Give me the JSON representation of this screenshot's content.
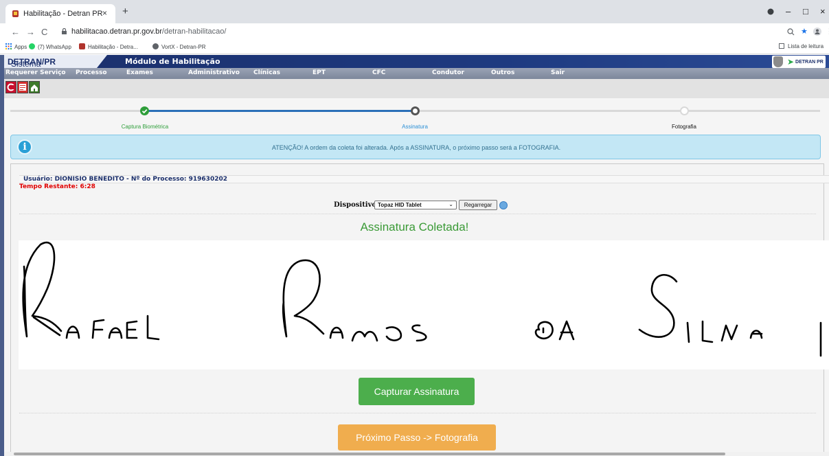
{
  "browser": {
    "tab_title": "Habilitação - Detran PR",
    "tab_close": "×",
    "new_tab": "+",
    "url_host": "habilitacao.detran.pr.gov.br",
    "url_path": "/detran-habilitacao/",
    "window_controls": [
      "–",
      "□",
      "×"
    ],
    "bookmarks": [
      "Apps",
      "(7) WhatsApp",
      "Habilitação - Detra...",
      "VortX - Detran-PR"
    ],
    "reading_list": "Lista de leitura"
  },
  "header": {
    "sistema_prefix": "Sistema",
    "sistema_bold": "DETRAN/PR",
    "modulo": "Módulo de Habilitação",
    "logo_text": "DETRAN PR"
  },
  "menu": [
    "Requerer Serviço",
    "Processo",
    "Exames",
    "Administrativo",
    "Clínicas",
    "EPT",
    "CFC",
    "Condutor",
    "Outros",
    "Sair"
  ],
  "stepper": {
    "steps": [
      {
        "label": "Captura Biométrica",
        "state": "done"
      },
      {
        "label": "Assinatura",
        "state": "current"
      },
      {
        "label": "Fotografia",
        "state": "pending"
      }
    ]
  },
  "alert": {
    "icon": "i",
    "text": "ATENÇÃO! A ordem da coleta foi alterada. Após a ASSINATURA, o próximo passo será a FOTOGRAFIA."
  },
  "process": {
    "user_line": "Usuário: DIONISIO BENEDITO - Nº do Processo: 919630202",
    "tempo": "Tempo Restante: 6:28"
  },
  "device": {
    "label": "Dispositivo:",
    "selected": "Topaz HID Tablet",
    "reload": "Regarregar"
  },
  "signature": {
    "status": "Assinatura Coletada!"
  },
  "buttons": {
    "capture": "Capturar Assinatura",
    "next": "Próximo Passo -> Fotografia"
  },
  "colors": {
    "step_done": "#2e9e3a",
    "step_active": "#2a6fb8",
    "btn_green": "#4cae4c",
    "btn_orange": "#f0ad4e",
    "alert_bg": "#c3e7f5"
  }
}
